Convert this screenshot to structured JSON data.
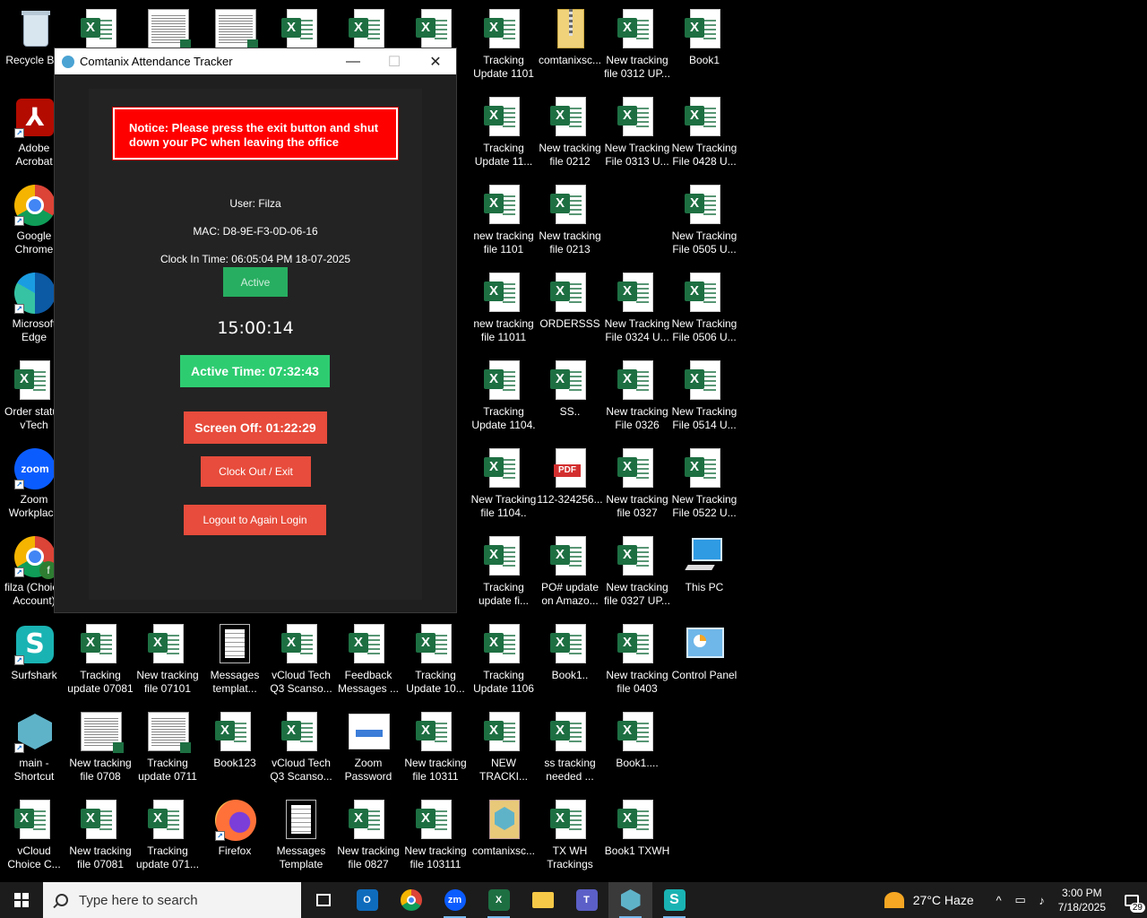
{
  "desktop": {
    "icons": {
      "c0": [
        "Recycle Bin",
        "Adobe Acrobat",
        "Google Chrome",
        "Microsoft Edge",
        "Order status vTech",
        "Zoom Workplace",
        "filza (Choice Account)",
        "Surfshark",
        "main - Shortcut",
        "vCloud Choice C..."
      ],
      "c1": [
        "",
        "New tracking file 07101",
        "New tracking file 0708",
        "New tracking file 07081"
      ],
      "c2": [
        "",
        "Tracking update 07081",
        "Tracking update 0711",
        "Tracking update 071..."
      ],
      "c3": [
        "",
        "Messages templat...",
        "Book123",
        "Firefox"
      ],
      "c4": [
        "",
        "vCloud Tech Q3 Scanso...",
        "vCloud Tech Q3 Scanso...",
        "Messages Template"
      ],
      "c5": [
        "",
        "Feedback Messages ...",
        "Zoom Password",
        "New tracking file 0827"
      ],
      "c6": [
        "",
        "Tracking Update 10...",
        "New tracking file 10311",
        "New tracking file 103111"
      ],
      "c7": [
        "Tracking Update 1101",
        "Tracking Update 11...",
        "new tracking file 1101",
        "new tracking file 11011",
        "Tracking Update 1104.",
        "New Tracking file 1104..",
        "Tracking update fi...",
        "Tracking Update 1106",
        "NEW TRACKI...",
        "comtanixsc..."
      ],
      "c8": [
        "comtanixsc...",
        "New tracking file 0212",
        "New tracking file 0213",
        "ORDERSSS",
        "SS..",
        "112-324256...",
        "PO# update on Amazo...",
        "Book1..",
        "ss tracking needed ...",
        "TX WH Trackings"
      ],
      "c9": [
        "New tracking file 0312 UP...",
        "New Tracking File 0313 U...",
        "New Tracking File 0324 U...",
        "New tracking File 0326",
        "New tracking file 0327",
        "New tracking file 0327 UP...",
        "New tracking file 0403",
        "Book1....",
        "Book1 TXWH"
      ],
      "c10": [
        "Book1",
        "New Tracking File 0428 U...",
        "New Tracking File 0505 U...",
        "New Tracking File 0506 U...",
        "New Tracking File 0514 U...",
        "New Tracking File 0522 U...",
        "This PC",
        "Control Panel"
      ]
    }
  },
  "app": {
    "title": "Comtanix Attendance Tracker",
    "controls": {
      "minimize": "—",
      "maximize": "☐",
      "close": "✕"
    },
    "notice": "Notice: Please press the exit button and shut down your PC when leaving the office",
    "user": "User: Filza",
    "mac": "MAC: D8-9E-F3-0D-06-16",
    "clock_in": "Clock In Time: 06:05:04 PM 18-07-2025",
    "status": "Active",
    "clock": "15:00:14",
    "active_time": "Active Time: 07:32:43",
    "screen_off": "Screen Off: 01:22:29",
    "clock_out": "Clock Out / Exit",
    "logout": "Logout to Again Login"
  },
  "taskbar": {
    "search_placeholder": "Type here to search",
    "weather": "27°C  Haze",
    "time": "3:00 PM",
    "date": "7/18/2025",
    "notifications": "29"
  }
}
